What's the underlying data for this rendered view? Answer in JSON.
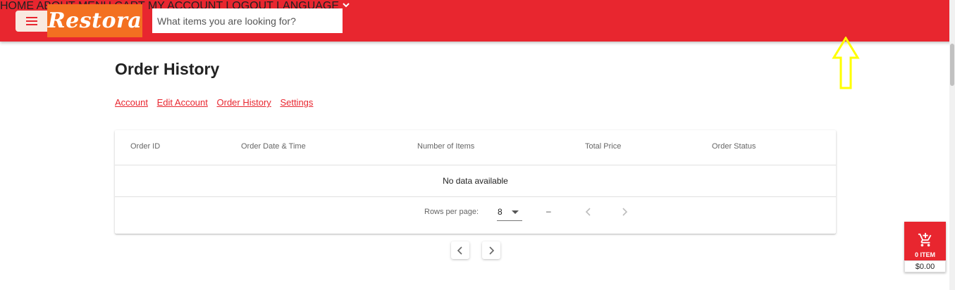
{
  "header": {
    "logo_text": "Restora",
    "search_placeholder": "What items you are looking for?",
    "nav": {
      "home": "HOME",
      "about": "ABOUT",
      "menu": "MENU",
      "cart": "CART",
      "my_account": "MY ACCOUNT",
      "logout": "LOGOUT",
      "language": "LANGUAGE"
    }
  },
  "page": {
    "title": "Order History",
    "links": {
      "account": "Account",
      "edit_account": "Edit Account",
      "order_history": "Order History",
      "settings": "Settings"
    }
  },
  "table": {
    "columns": {
      "order_id": "Order ID",
      "order_date": "Order Date & Time",
      "num_items": "Number of Items",
      "total_price": "Total Price",
      "order_status": "Order Status"
    },
    "empty_text": "No data available",
    "footer": {
      "rows_label": "Rows per page:",
      "rows_value": "8",
      "range": "–"
    }
  },
  "cart_widget": {
    "count": "0 ITEM",
    "price": "$0.00"
  },
  "colors": {
    "brand_red": "#e8262f",
    "logo_orange": "#f37021",
    "annotation_yellow": "#ffff00"
  }
}
